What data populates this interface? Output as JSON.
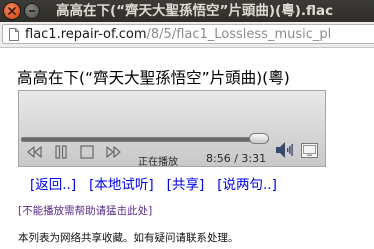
{
  "window": {
    "title": "高高在下(“齊天大聖孫悟空”片頭曲)(粵).flac"
  },
  "address_bar": {
    "url_domain": "flac1.repair-of.com",
    "url_path": "/8/5/flac1_Lossless_music_pl"
  },
  "page": {
    "heading": "高高在下(“齊天大聖孫悟空”片頭曲)(粵)"
  },
  "player": {
    "status": "正在播放",
    "time": "8:56 / 3:31",
    "progress_fraction": 1.0
  },
  "links": [
    {
      "label": "[返回..]"
    },
    {
      "label": "[本地试听]"
    },
    {
      "label": "[共享]"
    },
    {
      "label": "[说两句..]"
    }
  ],
  "help_link": "[不能播放需帮助请猛击此处]",
  "notice": "本列表为网络共享收藏。如有疑问请联系处理。",
  "colors": {
    "link": "#0000ee",
    "visited_link": "#5a2a8a",
    "titlebar": "#3c3b37",
    "close_button": "#e05a26"
  }
}
